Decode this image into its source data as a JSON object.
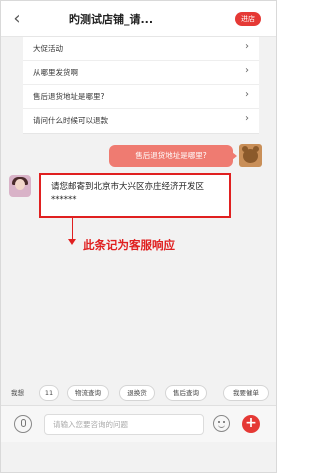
{
  "header": {
    "title": "旳测试店铺_请...",
    "enter_shop_label": "进店"
  },
  "faq": {
    "items": [
      {
        "label": "大促活动"
      },
      {
        "label": "从哪里发货啊"
      },
      {
        "label": "售后退货地址是哪里?"
      },
      {
        "label": "请问什么时候可以退款"
      }
    ]
  },
  "chat": {
    "user_message": "售后退货地址是哪里?",
    "service_message": "请您邮寄到北京市大兴区亦庄经济开发区******",
    "annotation": "此条记为客服响应"
  },
  "quick_replies": [
    {
      "label": "我想"
    },
    {
      "label": "11"
    },
    {
      "label": "物流查询"
    },
    {
      "label": "退换货"
    },
    {
      "label": "售后查询"
    },
    {
      "label": "我要催单"
    }
  ],
  "input": {
    "placeholder": "请输入您要咨询的问题"
  },
  "colors": {
    "accent": "#e53935",
    "user_bubble": "#ef7b71",
    "annotation": "#e02020"
  }
}
